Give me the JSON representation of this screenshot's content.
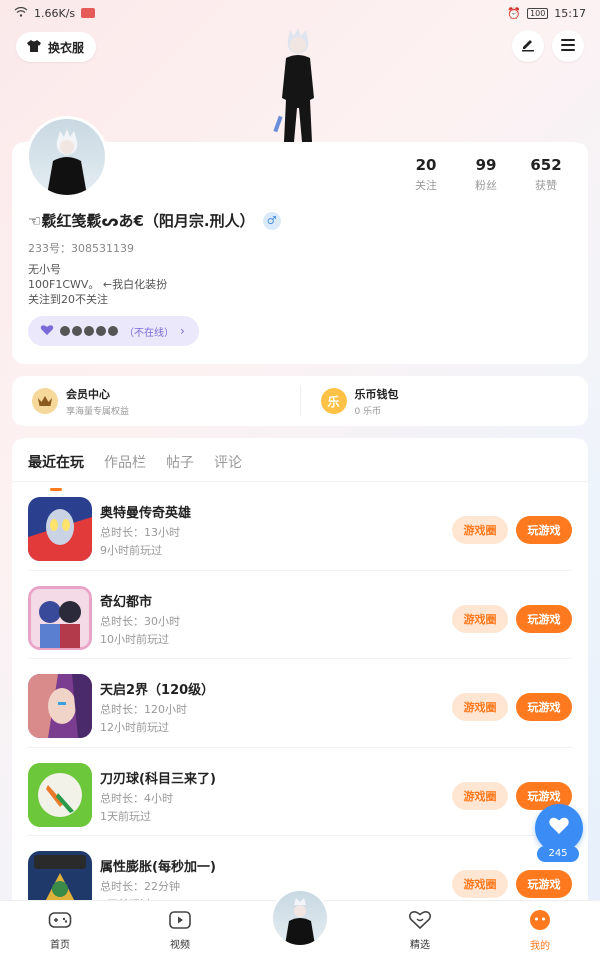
{
  "status_bar": {
    "network_speed": "1.66K/s",
    "battery": "100",
    "time": "15:17"
  },
  "header": {
    "outfit_label": "换衣服"
  },
  "profile": {
    "stats": [
      {
        "num": "20",
        "label": "关注"
      },
      {
        "num": "99",
        "label": "粉丝"
      },
      {
        "num": "652",
        "label": "获赞"
      }
    ],
    "username": "☜鬏红笺鬏ᔕあ€（阳月宗.刑人）",
    "gender": "♂",
    "uid": "233号：308531139",
    "bio": [
      "无小号",
      "100F1CWV。 ←我白化装扮",
      "关注到20不关注"
    ],
    "online_status": "（不在线）"
  },
  "member": {
    "vip_title": "会员中心",
    "vip_sub": "享海量专属权益",
    "wallet_title": "乐币钱包",
    "wallet_sub": "0 乐币",
    "wallet_icon_text": "乐"
  },
  "tabs": [
    "最近在玩",
    "作品栏",
    "帖子",
    "评论"
  ],
  "games": [
    {
      "name": "奥特曼传奇英雄",
      "duration": "总时长：13小时",
      "last": "9小时前玩过",
      "circle_label": "游戏圈",
      "play_label": "玩游戏"
    },
    {
      "name": "奇幻都市",
      "duration": "总时长：30小时",
      "last": "10小时前玩过",
      "circle_label": "游戏圈",
      "play_label": "玩游戏"
    },
    {
      "name": "天启2界（120级）",
      "duration": "总时长：120小时",
      "last": "12小时前玩过",
      "circle_label": "游戏圈",
      "play_label": "玩游戏"
    },
    {
      "name": "刀刃球(科目三来了)",
      "duration": "总时长：4小时",
      "last": "1天前玩过",
      "circle_label": "游戏圈",
      "play_label": "玩游戏"
    },
    {
      "name": "属性膨胀(每秒加一)",
      "duration": "总时长：22分钟",
      "last": "1天前玩过",
      "circle_label": "游戏圈",
      "play_label": "玩游戏"
    }
  ],
  "fab": {
    "count": "245"
  },
  "bottom_nav": [
    {
      "label": "首页"
    },
    {
      "label": "视频"
    },
    {
      "label": "精选"
    },
    {
      "label": "我的"
    }
  ],
  "colors": {
    "accent": "#ff7a1f",
    "fab": "#3b8df5",
    "purple_pill": "#ece8fb"
  }
}
